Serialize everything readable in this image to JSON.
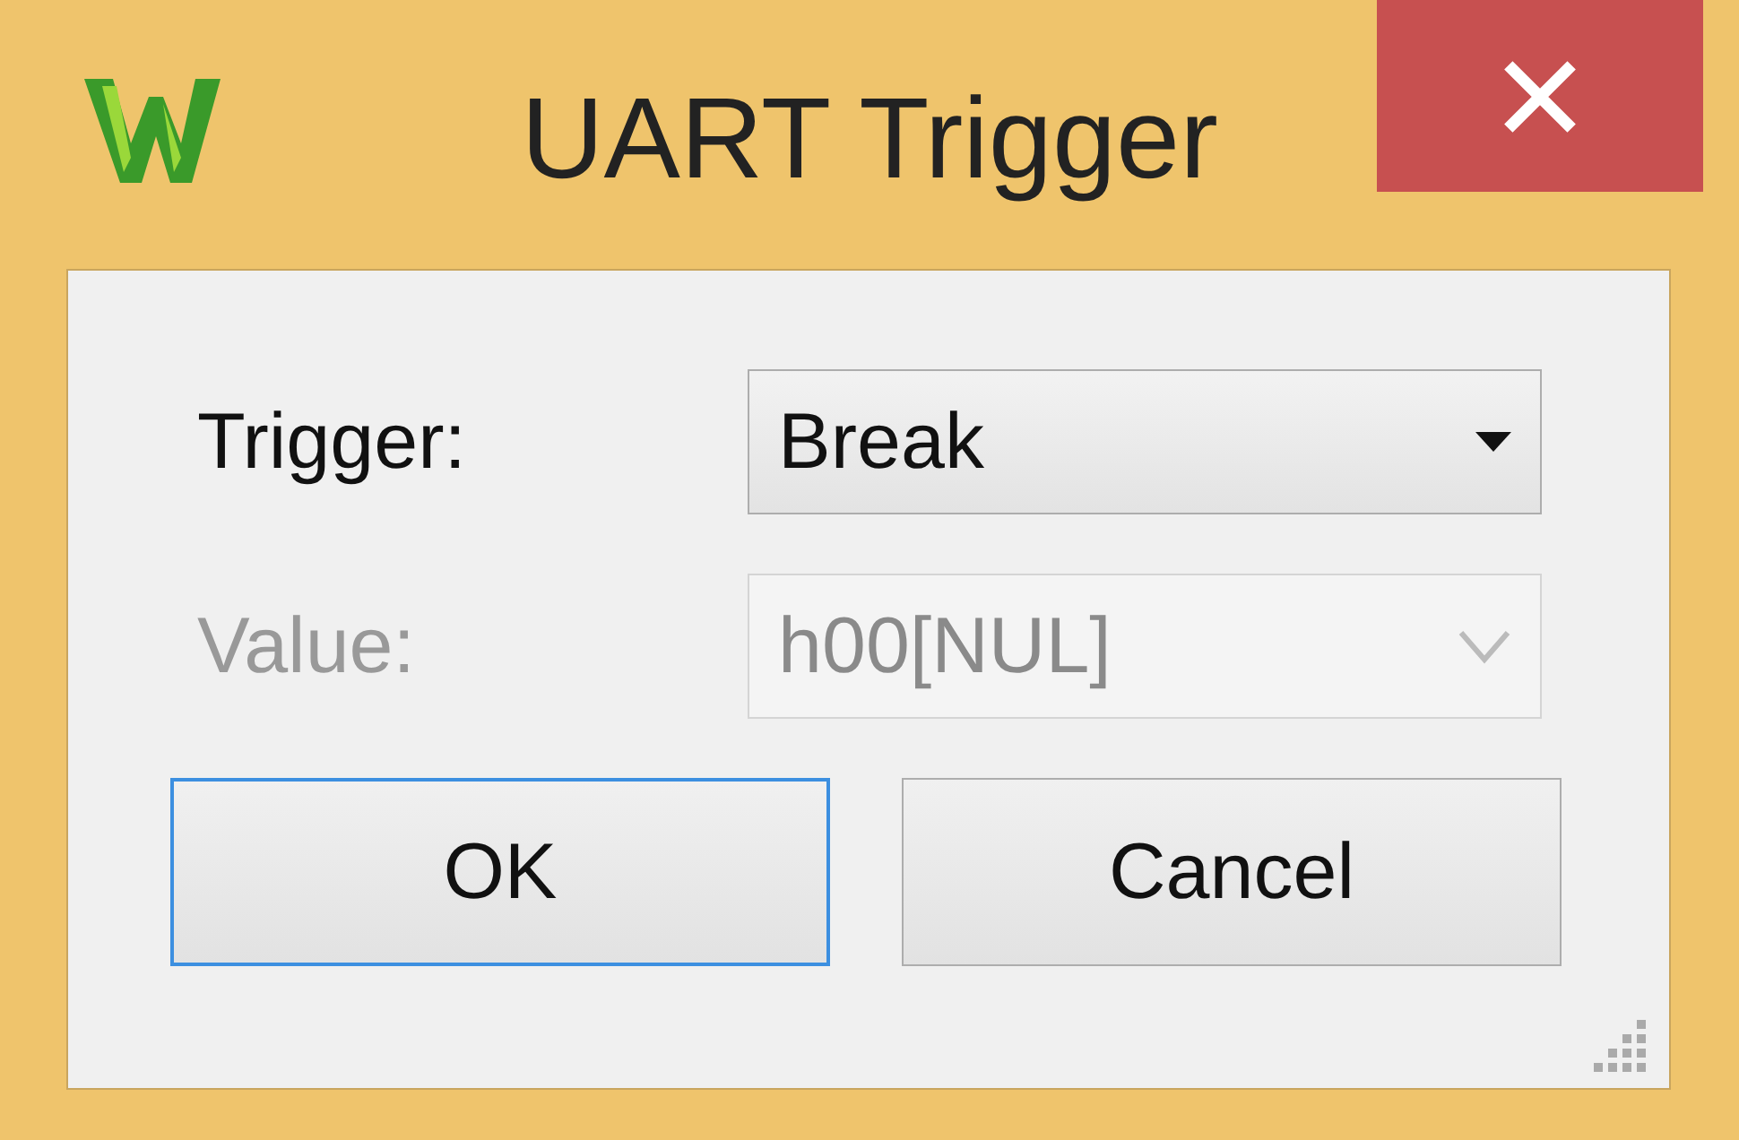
{
  "window": {
    "title": "UART Trigger"
  },
  "fields": [
    {
      "label": "Trigger:",
      "value": "Break",
      "disabled": false
    },
    {
      "label": "Value:",
      "value": "h00[NUL]",
      "disabled": true
    }
  ],
  "buttons": [
    {
      "label": "OK",
      "focused": true
    },
    {
      "label": "Cancel",
      "focused": false
    }
  ]
}
